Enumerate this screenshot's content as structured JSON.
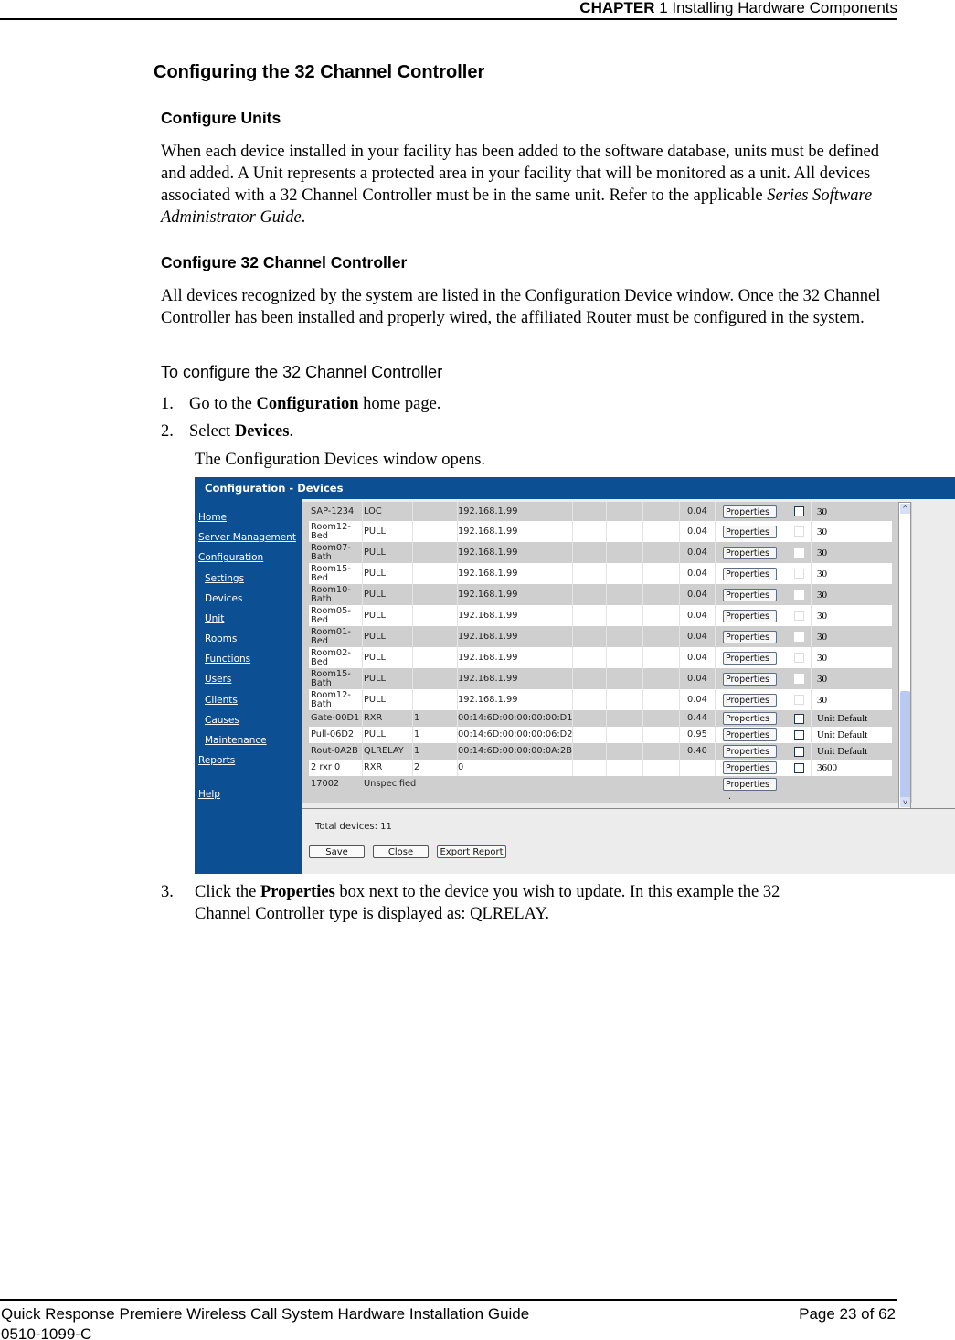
{
  "header": {
    "chapter_bold": "CHAPTER",
    "chapter_rest": " 1 Installing Hardware Components"
  },
  "title": "Configuring the 32 Channel Controller",
  "section1": {
    "heading": "Configure Units",
    "body_pre": "When each device installed in your facility has been added to the software database, units must be defined and added. A Unit represents a protected area in your facility that will be monitored as a unit. All devices associated with a 32 Channel Controller must be in the same unit. Refer to the applicable ",
    "body_italic": "Series Software Administrator Guide",
    "body_post": "."
  },
  "section2": {
    "heading": "Configure 32 Channel Controller",
    "body": "All devices recognized by the system are listed in the Configuration Device window. Once the 32 Channel Controller has been installed and properly wired, the affiliated Router must be configured in the system.",
    "procedure_title": "To configure the 32 Channel Controller",
    "steps": [
      {
        "num": "1.",
        "pre": "Go to the ",
        "bold": "Configuration",
        "post": " home page."
      },
      {
        "num": "2.",
        "pre": "Select ",
        "bold": "Devices",
        "post": "."
      },
      {
        "num": "3.",
        "pre": "Click the ",
        "bold": "Properties",
        "post": " box next to the device you wish to update. In this example the 32",
        "line2": "Channel Controller type is displayed as: QLRELAY."
      }
    ],
    "step2_result": "The Configuration Devices window opens."
  },
  "screenshot": {
    "title": "Configuration - Devices",
    "nav": [
      {
        "label": "Home",
        "indent": false,
        "current": false
      },
      {
        "label": "Server Management",
        "indent": false,
        "current": false
      },
      {
        "label": "Configuration",
        "indent": false,
        "current": false
      },
      {
        "label": "Settings",
        "indent": true,
        "current": false
      },
      {
        "label": "Devices",
        "indent": true,
        "current": true
      },
      {
        "label": "Unit",
        "indent": true,
        "current": false
      },
      {
        "label": "Rooms",
        "indent": true,
        "current": false
      },
      {
        "label": "Functions",
        "indent": true,
        "current": false
      },
      {
        "label": "Users",
        "indent": true,
        "current": false
      },
      {
        "label": "Clients",
        "indent": true,
        "current": false
      },
      {
        "label": "Causes",
        "indent": true,
        "current": false
      },
      {
        "label": "Maintenance",
        "indent": true,
        "current": false
      },
      {
        "label": "Reports",
        "indent": false,
        "current": false
      },
      {
        "label": "Help",
        "indent": false,
        "current": false
      }
    ],
    "properties_label": "Properties ..",
    "rows": [
      {
        "name": "SAP-1234",
        "type": "LOC",
        "ch": "",
        "addr": "192.168.1.99",
        "ver": "0.04",
        "check": "box",
        "value": "30"
      },
      {
        "name": "Room12-\nBed",
        "type": "PULL",
        "ch": "",
        "addr": "192.168.1.99",
        "ver": "0.04",
        "check": "faint",
        "value": "30"
      },
      {
        "name": "Room07-\nBath",
        "type": "PULL",
        "ch": "",
        "addr": "192.168.1.99",
        "ver": "0.04",
        "check": "blank",
        "value": "30"
      },
      {
        "name": "Room15-\nBed",
        "type": "PULL",
        "ch": "",
        "addr": "192.168.1.99",
        "ver": "0.04",
        "check": "faint",
        "value": "30"
      },
      {
        "name": "Room10-\nBath",
        "type": "PULL",
        "ch": "",
        "addr": "192.168.1.99",
        "ver": "0.04",
        "check": "blank",
        "value": "30"
      },
      {
        "name": "Room05-\nBed",
        "type": "PULL",
        "ch": "",
        "addr": "192.168.1.99",
        "ver": "0.04",
        "check": "faint",
        "value": "30"
      },
      {
        "name": "Room01-\nBed",
        "type": "PULL",
        "ch": "",
        "addr": "192.168.1.99",
        "ver": "0.04",
        "check": "blank",
        "value": "30"
      },
      {
        "name": "Room02-\nBed",
        "type": "PULL",
        "ch": "",
        "addr": "192.168.1.99",
        "ver": "0.04",
        "check": "faint",
        "value": "30"
      },
      {
        "name": "Room15-\nBath",
        "type": "PULL",
        "ch": "",
        "addr": "192.168.1.99",
        "ver": "0.04",
        "check": "blank",
        "value": "30"
      },
      {
        "name": "Room12-\nBath",
        "type": "PULL",
        "ch": "",
        "addr": "192.168.1.99",
        "ver": "0.04",
        "check": "faint",
        "value": "30"
      },
      {
        "name": "Gate-00D1",
        "type": "RXR",
        "ch": "1",
        "addr": "00:14:6D:00:00:00:00:D1",
        "ver": "0.44",
        "check": "box",
        "value": "Unit Default"
      },
      {
        "name": "Pull-06D2",
        "type": "PULL",
        "ch": "1",
        "addr": "00:14:6D:00:00:00:06:D2",
        "ver": "0.95",
        "check": "box",
        "value": "Unit Default"
      },
      {
        "name": "Rout-0A2B",
        "type": "QLRELAY",
        "ch": "1",
        "addr": "00:14:6D:00:00:00:0A:2B",
        "ver": "0.40",
        "check": "box",
        "value": "Unit Default"
      },
      {
        "name": "2 rxr 0",
        "type": "RXR",
        "ch": "2",
        "addr": "0",
        "ver": "",
        "check": "box",
        "value": "3600"
      },
      {
        "name": "17002",
        "type": "Unspecified",
        "ch": "",
        "addr": "",
        "ver": "",
        "check": "none",
        "value": ""
      }
    ],
    "total_label": "Total devices: 11",
    "buttons": {
      "save": "Save",
      "close": "Close",
      "export": "Export Report"
    }
  },
  "footer": {
    "guide": "Quick Response Premiere Wireless Call System Hardware Installation Guide",
    "doc_id": "0510-1099-C",
    "page": "Page 23 of 62"
  }
}
